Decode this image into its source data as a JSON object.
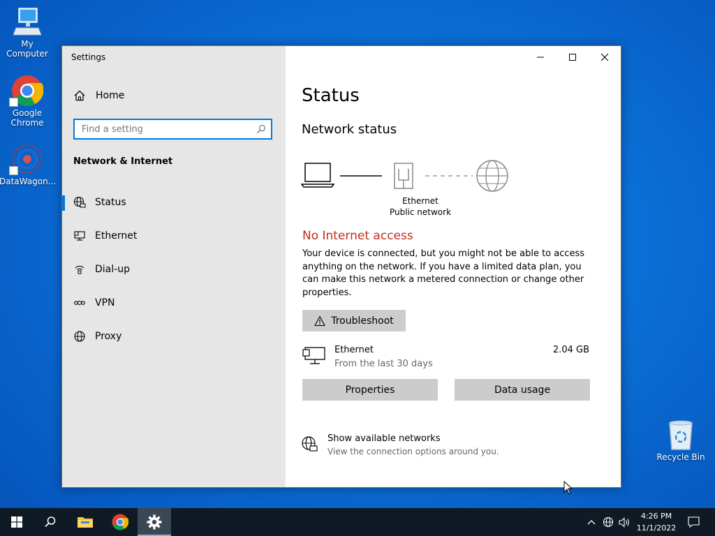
{
  "desktop": {
    "icons": [
      {
        "label": "My Computer"
      },
      {
        "label": "Google Chrome"
      },
      {
        "label": "DataWagon..."
      },
      {
        "label": "Recycle Bin"
      }
    ]
  },
  "window": {
    "title": "Settings"
  },
  "sidebar": {
    "home_label": "Home",
    "search_placeholder": "Find a setting",
    "section_title": "Network & Internet",
    "items": [
      {
        "label": "Status",
        "icon": "globe-status-icon",
        "active": true
      },
      {
        "label": "Ethernet",
        "icon": "ethernet-icon"
      },
      {
        "label": "Dial-up",
        "icon": "dialup-icon"
      },
      {
        "label": "VPN",
        "icon": "vpn-icon"
      },
      {
        "label": "Proxy",
        "icon": "globe-icon"
      }
    ]
  },
  "main": {
    "page_title": "Status",
    "network_status_heading": "Network status",
    "diagram": {
      "adapter_name": "Ethernet",
      "network_type": "Public network"
    },
    "status_message": "No Internet access",
    "description": "Your device is connected, but you might not be able to access anything on the network. If you have a limited data plan, you can make this network a metered connection or change other properties.",
    "troubleshoot_label": "Troubleshoot",
    "connection": {
      "name": "Ethernet",
      "period": "From the last 30 days",
      "data_used": "2.04 GB"
    },
    "properties_label": "Properties",
    "data_usage_label": "Data usage",
    "show_networks": {
      "title": "Show available networks",
      "subtitle": "View the connection options around you."
    }
  },
  "taskbar": {
    "time": "4:26 PM",
    "date": "11/1/2022"
  },
  "colors": {
    "accent": "#0078d7",
    "error": "#c42b1c",
    "sidebar_bg": "#e6e6e6",
    "button_bg": "#cccccc",
    "taskbar_bg": "#0f1a24"
  }
}
